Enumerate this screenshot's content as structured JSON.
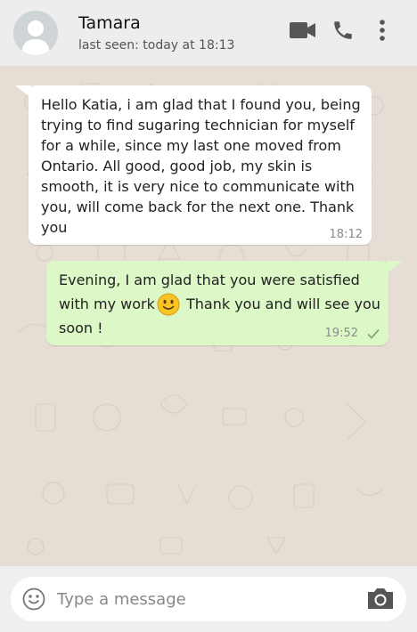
{
  "header": {
    "contact_name": "Tamara",
    "last_seen": "last seen: today at 18:13",
    "icons": [
      "video-icon",
      "phone-icon",
      "more-options-icon"
    ]
  },
  "messages": [
    {
      "direction": "incoming",
      "text": "Hello Katia, i am glad that I found you, being trying to find sugaring technician for myself for a while, since my last one moved from Ontario. All good, good job, my skin is smooth, it is very nice to communicate with you, will come back for the next one. Thank you",
      "time": "18:12"
    },
    {
      "direction": "outgoing",
      "text_before_emoji": "Evening, I am glad that you were satisfied with my work",
      "emoji": "slightly-smiling-face-icon",
      "text_after_emoji": " Thank you and will see you soon !",
      "time": "19:52",
      "status": "sent-single-check"
    }
  ],
  "composer": {
    "placeholder": "Type a message",
    "value": ""
  },
  "colors": {
    "header_bg": "#ededed",
    "chat_bg": "#e6ded5",
    "incoming_bubble": "#ffffff",
    "outgoing_bubble": "#dcf8c6",
    "icon_gray": "#555555"
  }
}
